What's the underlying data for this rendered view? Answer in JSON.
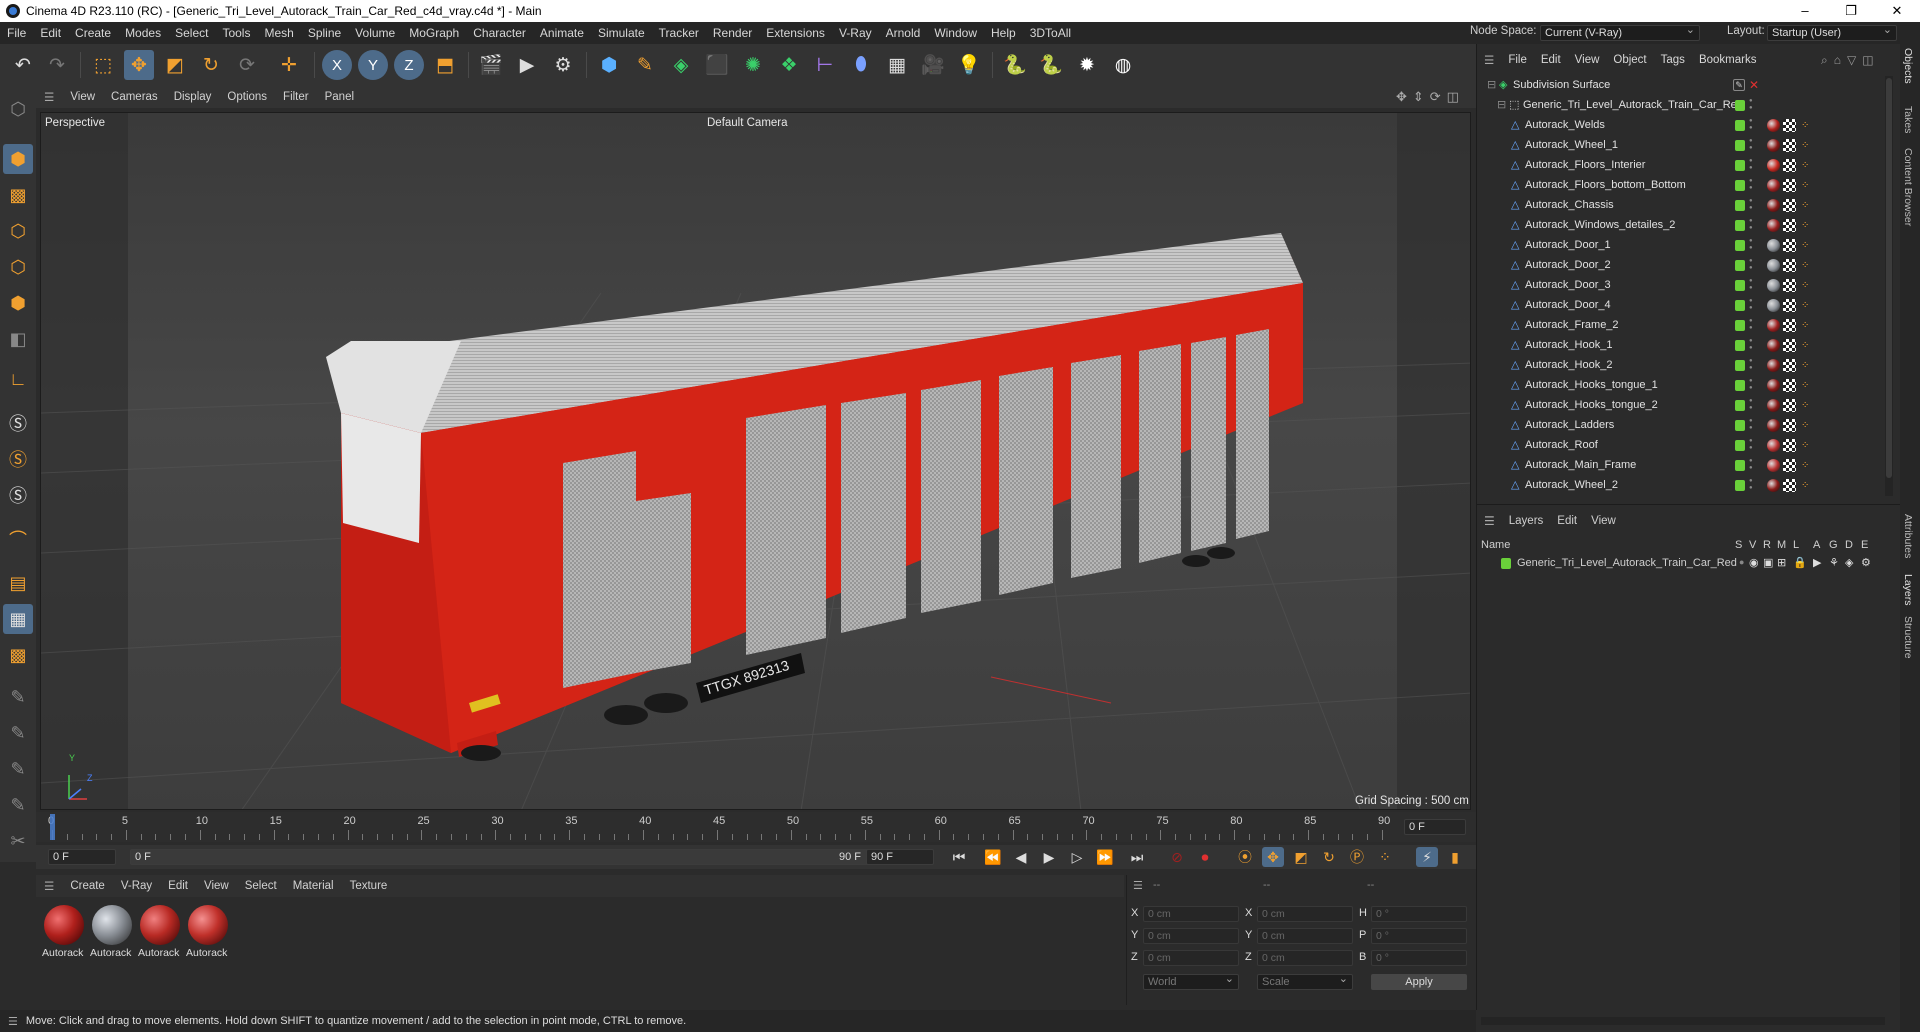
{
  "window": {
    "title": "Cinema 4D R23.110 (RC) - [Generic_Tri_Level_Autorack_Train_Car_Red_c4d_vray.c4d *] - Main",
    "controls": [
      "–",
      "❐",
      "✕"
    ]
  },
  "menubar": {
    "items": [
      "File",
      "Edit",
      "Create",
      "Modes",
      "Select",
      "Tools",
      "Mesh",
      "Spline",
      "Volume",
      "MoGraph",
      "Character",
      "Animate",
      "Simulate",
      "Tracker",
      "Render",
      "Extensions",
      "V-Ray",
      "Arnold",
      "Window",
      "Help",
      "3DToAll"
    ],
    "node_space_label": "Node Space:",
    "node_space_value": "Current (V-Ray)",
    "layout_label": "Layout:",
    "layout_value": "Startup (User)"
  },
  "toolbar": {
    "axis_x": "X",
    "axis_y": "Y",
    "axis_z": "Z"
  },
  "viewport": {
    "menu": [
      "View",
      "Cameras",
      "Display",
      "Options",
      "Filter",
      "Panel"
    ],
    "view_name": "Perspective",
    "camera": "Default Camera",
    "grid_spacing": "Grid Spacing : 500 cm",
    "car_marking": "TTGX 892313",
    "axis_labels": {
      "y": "Y",
      "z": "Z"
    }
  },
  "timeline": {
    "ticks": [
      "0",
      "5",
      "10",
      "15",
      "20",
      "25",
      "30",
      "35",
      "40",
      "45",
      "50",
      "55",
      "60",
      "65",
      "70",
      "75",
      "80",
      "85",
      "90"
    ],
    "current_frame_field": "0 F",
    "start_field": "0 F",
    "range_start": "0 F",
    "range_end": "90 F",
    "end_field": "90 F",
    "max_field": "0 F"
  },
  "material_manager": {
    "menu": [
      "Create",
      "V-Ray",
      "Edit",
      "View",
      "Select",
      "Material",
      "Texture"
    ],
    "materials": [
      {
        "name": "Autorack",
        "color": "#b0201c"
      },
      {
        "name": "Autorack",
        "color": "#8a8f96"
      },
      {
        "name": "Autorack",
        "color": "#b82a24"
      },
      {
        "name": "Autorack",
        "color": "#c0302a"
      }
    ]
  },
  "coordinates": {
    "header": [
      "--",
      "--",
      "--"
    ],
    "rows": [
      {
        "a": "X",
        "av": "0 cm",
        "b": "X",
        "bv": "0 cm",
        "c": "H",
        "cv": "0 °"
      },
      {
        "a": "Y",
        "av": "0 cm",
        "b": "Y",
        "bv": "0 cm",
        "c": "P",
        "cv": "0 °"
      },
      {
        "a": "Z",
        "av": "0 cm",
        "b": "Z",
        "bv": "0 cm",
        "c": "B",
        "cv": "0 °"
      }
    ],
    "mode": "World",
    "scale": "Scale",
    "apply": "Apply"
  },
  "status": {
    "text": "Move: Click and drag to move elements. Hold down SHIFT to quantize movement / add to the selection in point mode, CTRL to remove."
  },
  "objects_panel": {
    "menu": [
      "File",
      "Edit",
      "View",
      "Object",
      "Tags",
      "Bookmarks"
    ],
    "root": "Subdivision Surface",
    "group": "Generic_Tri_Level_Autorack_Train_Car_Red",
    "children": [
      "Autorack_Welds",
      "Autorack_Wheel_1",
      "Autorack_Floors_Interier",
      "Autorack_Floors_bottom_Bottom",
      "Autorack_Chassis",
      "Autorack_Windows_detailes_2",
      "Autorack_Door_1",
      "Autorack_Door_2",
      "Autorack_Door_3",
      "Autorack_Door_4",
      "Autorack_Frame_2",
      "Autorack_Hook_1",
      "Autorack_Hook_2",
      "Autorack_Hooks_tongue_1",
      "Autorack_Hooks_tongue_2",
      "Autorack_Ladders",
      "Autorack_Roof",
      "Autorack_Main_Frame",
      "Autorack_Wheel_2"
    ],
    "tag_colors": [
      "#b0201c",
      "#8a1a18",
      "#c82820",
      "#a02020",
      "#8a1a18",
      "#9a2020",
      "#8a8f96",
      "#8a8f96",
      "#8a8f96",
      "#8a8f96",
      "#a02020",
      "#8a1a18",
      "#8a1a18",
      "#8a1a18",
      "#8a1a18",
      "#8a1a18",
      "#b83030",
      "#b83030",
      "#8a1a18"
    ]
  },
  "layers_panel": {
    "menu": [
      "Layers",
      "Edit",
      "View"
    ],
    "columns": [
      "Name",
      "S",
      "V",
      "R",
      "M",
      "L",
      "A",
      "G",
      "D",
      "E"
    ],
    "layer_name": "Generic_Tri_Level_Autorack_Train_Car_Red",
    "layer_color": "#6ad03a"
  },
  "right_tabs": [
    "Objects",
    "Takes",
    "Content Browser",
    "Attributes",
    "Layers",
    "Structure"
  ]
}
